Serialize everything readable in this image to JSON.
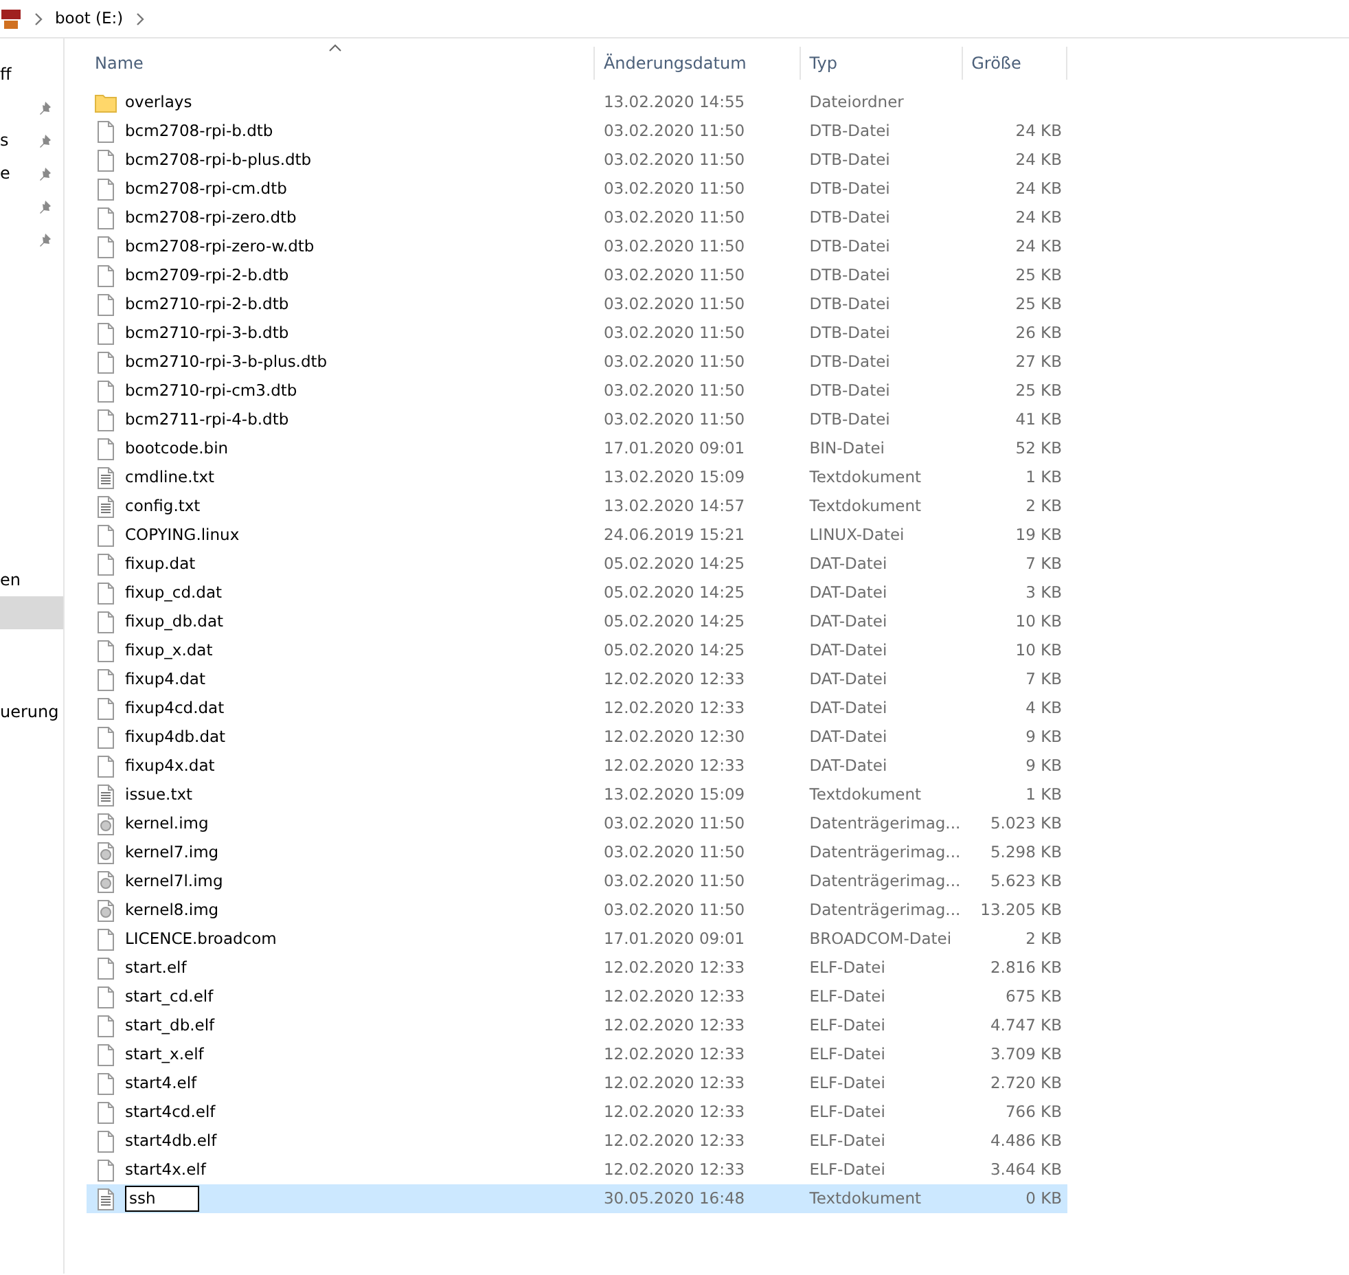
{
  "address_bar": {
    "segments": [
      {
        "label": "boot (E:)"
      }
    ]
  },
  "navigation_pane": {
    "groups": [
      {
        "items": [
          {
            "label": "ff",
            "pinned": false,
            "selected": false
          },
          {
            "pinned": true,
            "selected": false
          },
          {
            "label": "s",
            "pinned": true,
            "selected": false
          },
          {
            "label": "e",
            "pinned": true,
            "selected": false
          },
          {
            "pinned": true,
            "selected": false
          },
          {
            "pinned": true,
            "selected": false
          }
        ]
      },
      {
        "items": [
          {
            "label": "en",
            "selected": false
          },
          {
            "selected": true
          }
        ]
      },
      {
        "items": [
          {
            "label": "uerung",
            "selected": false
          }
        ]
      }
    ]
  },
  "table": {
    "columns": [
      {
        "label": "Name",
        "sorted": true
      },
      {
        "label": "Änderungsdatum",
        "sorted": false
      },
      {
        "label": "Typ",
        "sorted": false
      },
      {
        "label": "Größe",
        "sorted": false
      }
    ],
    "rows": [
      {
        "kind": "folder",
        "name": "overlays",
        "date": "13.02.2020 14:55",
        "type": "Dateiordner",
        "selected": false,
        "renaming": false
      },
      {
        "kind": "file",
        "name": "bcm2708-rpi-b.dtb",
        "date": "03.02.2020 11:50",
        "type": "DTB-Datei",
        "size": "24 KB",
        "selected": false,
        "renaming": false
      },
      {
        "kind": "file",
        "name": "bcm2708-rpi-b-plus.dtb",
        "date": "03.02.2020 11:50",
        "type": "DTB-Datei",
        "size": "24 KB",
        "selected": false,
        "renaming": false
      },
      {
        "kind": "file",
        "name": "bcm2708-rpi-cm.dtb",
        "date": "03.02.2020 11:50",
        "type": "DTB-Datei",
        "size": "24 KB",
        "selected": false,
        "renaming": false
      },
      {
        "kind": "file",
        "name": "bcm2708-rpi-zero.dtb",
        "date": "03.02.2020 11:50",
        "type": "DTB-Datei",
        "size": "24 KB",
        "selected": false,
        "renaming": false
      },
      {
        "kind": "file",
        "name": "bcm2708-rpi-zero-w.dtb",
        "date": "03.02.2020 11:50",
        "type": "DTB-Datei",
        "size": "24 KB",
        "selected": false,
        "renaming": false
      },
      {
        "kind": "file",
        "name": "bcm2709-rpi-2-b.dtb",
        "date": "03.02.2020 11:50",
        "type": "DTB-Datei",
        "size": "25 KB",
        "selected": false,
        "renaming": false
      },
      {
        "kind": "file",
        "name": "bcm2710-rpi-2-b.dtb",
        "date": "03.02.2020 11:50",
        "type": "DTB-Datei",
        "size": "25 KB",
        "selected": false,
        "renaming": false
      },
      {
        "kind": "file",
        "name": "bcm2710-rpi-3-b.dtb",
        "date": "03.02.2020 11:50",
        "type": "DTB-Datei",
        "size": "26 KB",
        "selected": false,
        "renaming": false
      },
      {
        "kind": "file",
        "name": "bcm2710-rpi-3-b-plus.dtb",
        "date": "03.02.2020 11:50",
        "type": "DTB-Datei",
        "size": "27 KB",
        "selected": false,
        "renaming": false
      },
      {
        "kind": "file",
        "name": "bcm2710-rpi-cm3.dtb",
        "date": "03.02.2020 11:50",
        "type": "DTB-Datei",
        "size": "25 KB",
        "selected": false,
        "renaming": false
      },
      {
        "kind": "file",
        "name": "bcm2711-rpi-4-b.dtb",
        "date": "03.02.2020 11:50",
        "type": "DTB-Datei",
        "size": "41 KB",
        "selected": false,
        "renaming": false
      },
      {
        "kind": "file",
        "name": "bootcode.bin",
        "date": "17.01.2020 09:01",
        "type": "BIN-Datei",
        "size": "52 KB",
        "selected": false,
        "renaming": false
      },
      {
        "kind": "text",
        "name": "cmdline.txt",
        "date": "13.02.2020 15:09",
        "type": "Textdokument",
        "size": "1 KB",
        "selected": false,
        "renaming": false
      },
      {
        "kind": "text",
        "name": "config.txt",
        "date": "13.02.2020 14:57",
        "type": "Textdokument",
        "size": "2 KB",
        "selected": false,
        "renaming": false
      },
      {
        "kind": "file",
        "name": "COPYING.linux",
        "date": "24.06.2019 15:21",
        "type": "LINUX-Datei",
        "size": "19 KB",
        "selected": false,
        "renaming": false
      },
      {
        "kind": "file",
        "name": "fixup.dat",
        "date": "05.02.2020 14:25",
        "type": "DAT-Datei",
        "size": "7 KB",
        "selected": false,
        "renaming": false
      },
      {
        "kind": "file",
        "name": "fixup_cd.dat",
        "date": "05.02.2020 14:25",
        "type": "DAT-Datei",
        "size": "3 KB",
        "selected": false,
        "renaming": false
      },
      {
        "kind": "file",
        "name": "fixup_db.dat",
        "date": "05.02.2020 14:25",
        "type": "DAT-Datei",
        "size": "10 KB",
        "selected": false,
        "renaming": false
      },
      {
        "kind": "file",
        "name": "fixup_x.dat",
        "date": "05.02.2020 14:25",
        "type": "DAT-Datei",
        "size": "10 KB",
        "selected": false,
        "renaming": false
      },
      {
        "kind": "file",
        "name": "fixup4.dat",
        "date": "12.02.2020 12:33",
        "type": "DAT-Datei",
        "size": "7 KB",
        "selected": false,
        "renaming": false
      },
      {
        "kind": "file",
        "name": "fixup4cd.dat",
        "date": "12.02.2020 12:33",
        "type": "DAT-Datei",
        "size": "4 KB",
        "selected": false,
        "renaming": false
      },
      {
        "kind": "file",
        "name": "fixup4db.dat",
        "date": "12.02.2020 12:30",
        "type": "DAT-Datei",
        "size": "9 KB",
        "selected": false,
        "renaming": false
      },
      {
        "kind": "file",
        "name": "fixup4x.dat",
        "date": "12.02.2020 12:33",
        "type": "DAT-Datei",
        "size": "9 KB",
        "selected": false,
        "renaming": false
      },
      {
        "kind": "text",
        "name": "issue.txt",
        "date": "13.02.2020 15:09",
        "type": "Textdokument",
        "size": "1 KB",
        "selected": false,
        "renaming": false
      },
      {
        "kind": "disc",
        "name": "kernel.img",
        "date": "03.02.2020 11:50",
        "type": "Datenträgerimag...",
        "size": "5.023 KB",
        "selected": false,
        "renaming": false
      },
      {
        "kind": "disc",
        "name": "kernel7.img",
        "date": "03.02.2020 11:50",
        "type": "Datenträgerimag...",
        "size": "5.298 KB",
        "selected": false,
        "renaming": false
      },
      {
        "kind": "disc",
        "name": "kernel7l.img",
        "date": "03.02.2020 11:50",
        "type": "Datenträgerimag...",
        "size": "5.623 KB",
        "selected": false,
        "renaming": false
      },
      {
        "kind": "disc",
        "name": "kernel8.img",
        "date": "03.02.2020 11:50",
        "type": "Datenträgerimag...",
        "size": "13.205 KB",
        "selected": false,
        "renaming": false
      },
      {
        "kind": "file",
        "name": "LICENCE.broadcom",
        "date": "17.01.2020 09:01",
        "type": "BROADCOM-Datei",
        "size": "2 KB",
        "selected": false,
        "renaming": false
      },
      {
        "kind": "file",
        "name": "start.elf",
        "date": "12.02.2020 12:33",
        "type": "ELF-Datei",
        "size": "2.816 KB",
        "selected": false,
        "renaming": false
      },
      {
        "kind": "file",
        "name": "start_cd.elf",
        "date": "12.02.2020 12:33",
        "type": "ELF-Datei",
        "size": "675 KB",
        "selected": false,
        "renaming": false
      },
      {
        "kind": "file",
        "name": "start_db.elf",
        "date": "12.02.2020 12:33",
        "type": "ELF-Datei",
        "size": "4.747 KB",
        "selected": false,
        "renaming": false
      },
      {
        "kind": "file",
        "name": "start_x.elf",
        "date": "12.02.2020 12:33",
        "type": "ELF-Datei",
        "size": "3.709 KB",
        "selected": false,
        "renaming": false
      },
      {
        "kind": "file",
        "name": "start4.elf",
        "date": "12.02.2020 12:33",
        "type": "ELF-Datei",
        "size": "2.720 KB",
        "selected": false,
        "renaming": false
      },
      {
        "kind": "file",
        "name": "start4cd.elf",
        "date": "12.02.2020 12:33",
        "type": "ELF-Datei",
        "size": "766 KB",
        "selected": false,
        "renaming": false
      },
      {
        "kind": "file",
        "name": "start4db.elf",
        "date": "12.02.2020 12:33",
        "type": "ELF-Datei",
        "size": "4.486 KB",
        "selected": false,
        "renaming": false
      },
      {
        "kind": "file",
        "name": "start4x.elf",
        "date": "12.02.2020 12:33",
        "type": "ELF-Datei",
        "size": "3.464 KB",
        "selected": false,
        "renaming": false
      },
      {
        "kind": "text",
        "name": "ssh",
        "date": "30.05.2020 16:48",
        "type": "Textdokument",
        "size": "0 KB",
        "selected": true,
        "renaming": true
      }
    ]
  }
}
